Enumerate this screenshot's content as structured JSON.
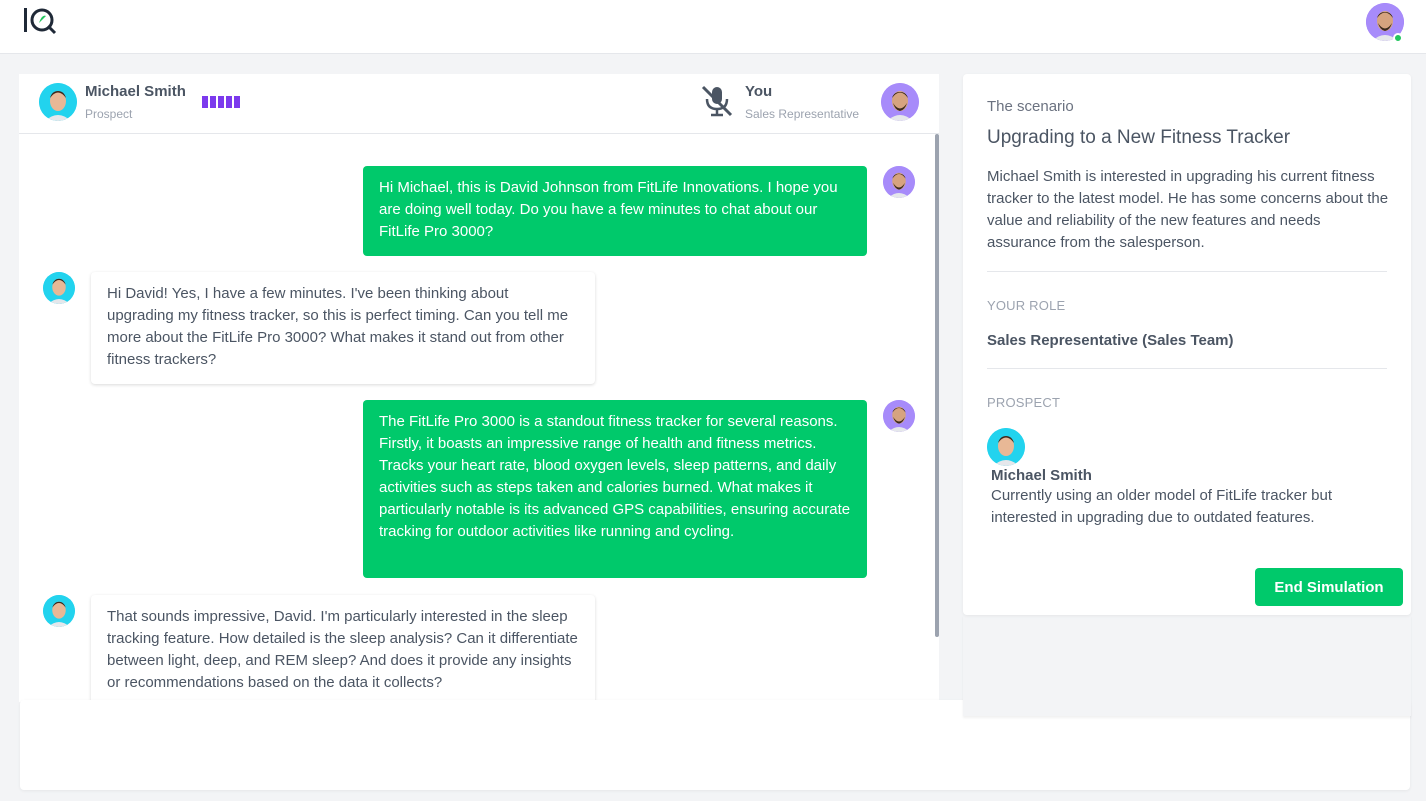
{
  "app": {
    "logo_text": "IQ"
  },
  "colors": {
    "accent_green": "#00c96b",
    "accent_purple": "#7c3aed",
    "online": "#22c55e"
  },
  "header": {
    "user_avatar_icon": "user-avatar-icon",
    "user_status": "online"
  },
  "call": {
    "prospect_name": "Michael Smith",
    "prospect_role": "Prospect",
    "rep_name": "You",
    "rep_role": "Sales Representative",
    "mic_icon": "mic-off-icon"
  },
  "messages": [
    {
      "from": "rep",
      "text": "Hi Michael, this is David Johnson from FitLife Innovations. I hope you are doing well today. Do you have a few minutes to chat about our FitLife Pro 3000?"
    },
    {
      "from": "prospect",
      "text": "Hi David! Yes, I have a few minutes. I've been thinking about upgrading my fitness tracker, so this is perfect timing. Can you tell me more about the FitLife Pro 3000? What makes it stand out from other fitness trackers?"
    },
    {
      "from": "rep",
      "text": "The FitLife Pro 3000 is a standout fitness tracker for several reasons. Firstly, it boasts an impressive range of health and fitness metrics. Tracks your heart rate, blood oxygen levels, sleep patterns, and daily activities such as steps taken and calories burned. What makes it particularly notable is its advanced GPS capabilities, ensuring accurate tracking for outdoor activities like running and cycling."
    },
    {
      "from": "prospect",
      "text": "That sounds impressive, David. I'm particularly interested in the sleep tracking feature. How detailed is the sleep analysis? Can it differentiate between light, deep, and REM sleep? And does it provide any insights or recommendations based on the data it collects?"
    }
  ],
  "scenario": {
    "label": "The scenario",
    "title": "Upgrading to a New Fitness Tracker",
    "description": "Michael Smith is interested in upgrading his current fitness tracker to the latest model. He has some concerns about the value and reliability of the new features and needs assurance from the salesperson.",
    "role_label": "YOUR ROLE",
    "role_value": "Sales Representative (Sales Team)",
    "prospect_label": "PROSPECT",
    "prospect_name": "Michael Smith",
    "prospect_desc": "Currently using an older model of FitLife tracker but interested in upgrading due to outdated features.",
    "end_button": "End Simulation"
  }
}
